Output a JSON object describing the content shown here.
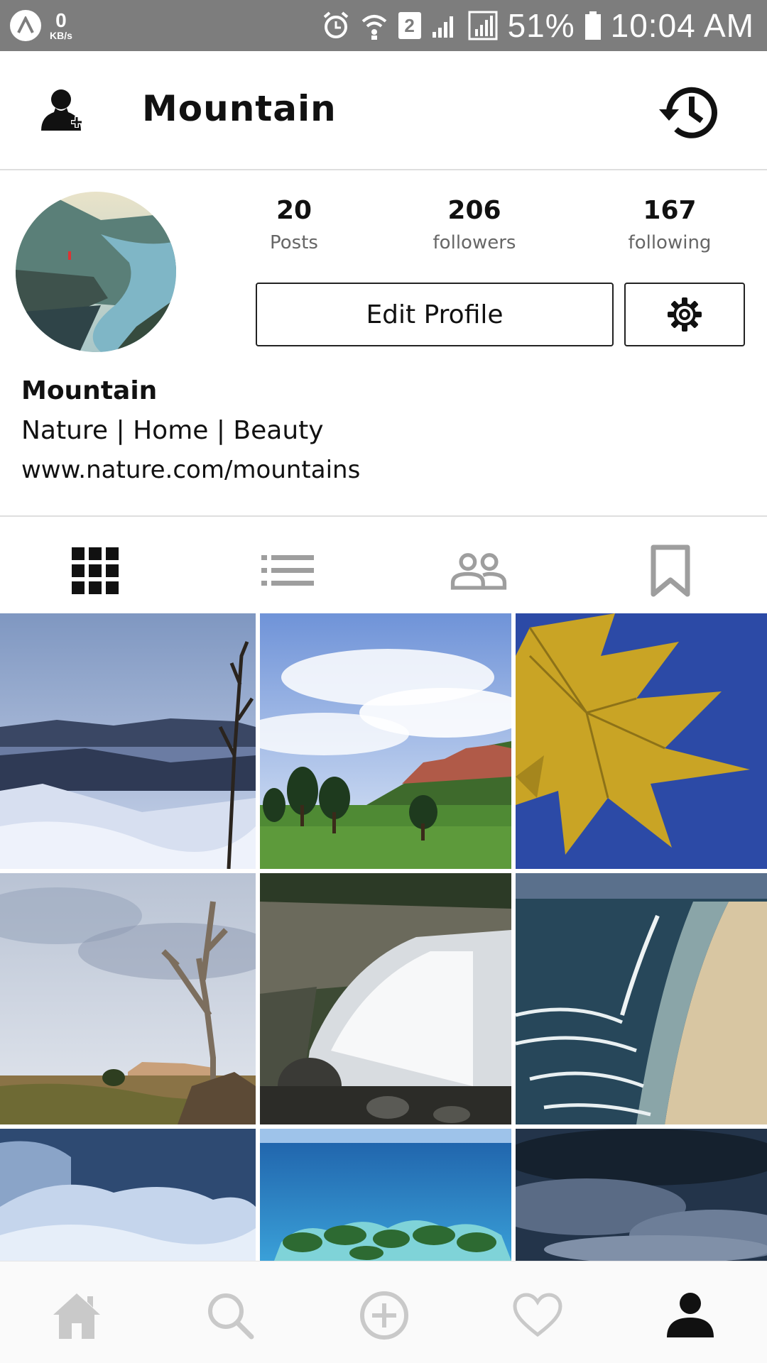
{
  "status_bar": {
    "network_speed": "0",
    "network_unit": "KB/s",
    "sim_badge": "2",
    "battery": "51%",
    "time": "10:04 AM"
  },
  "header": {
    "title": "Mountain"
  },
  "profile": {
    "stats": [
      {
        "value": "20",
        "label": "Posts"
      },
      {
        "value": "206",
        "label": "followers"
      },
      {
        "value": "167",
        "label": "following"
      }
    ],
    "edit_button_label": "Edit Profile",
    "name": "Mountain",
    "bio": "Nature | Home | Beauty",
    "website": "www.nature.com/mountains"
  },
  "tabs": [
    {
      "icon": "grid-icon",
      "active": true
    },
    {
      "icon": "list-icon",
      "active": false
    },
    {
      "icon": "tagged-people-icon",
      "active": false
    },
    {
      "icon": "bookmark-icon",
      "active": false
    }
  ],
  "photos": [
    "snowy-mountain-lake",
    "green-meadow-red-rocks",
    "yellow-maple-leaf",
    "dead-tree-desert",
    "waterfall",
    "coastline-beach",
    "snow-drifts",
    "tropical-islands",
    "cloudy-sky"
  ],
  "bottom_nav": [
    "home-icon",
    "search-icon",
    "add-post-icon",
    "heart-icon",
    "profile-icon"
  ],
  "colors": {
    "status_bar": "#7d7d7d",
    "text": "#111111",
    "muted": "#666666",
    "inactive_icon": "#a8a8a8",
    "nav_inactive": "#c9c9c9"
  }
}
